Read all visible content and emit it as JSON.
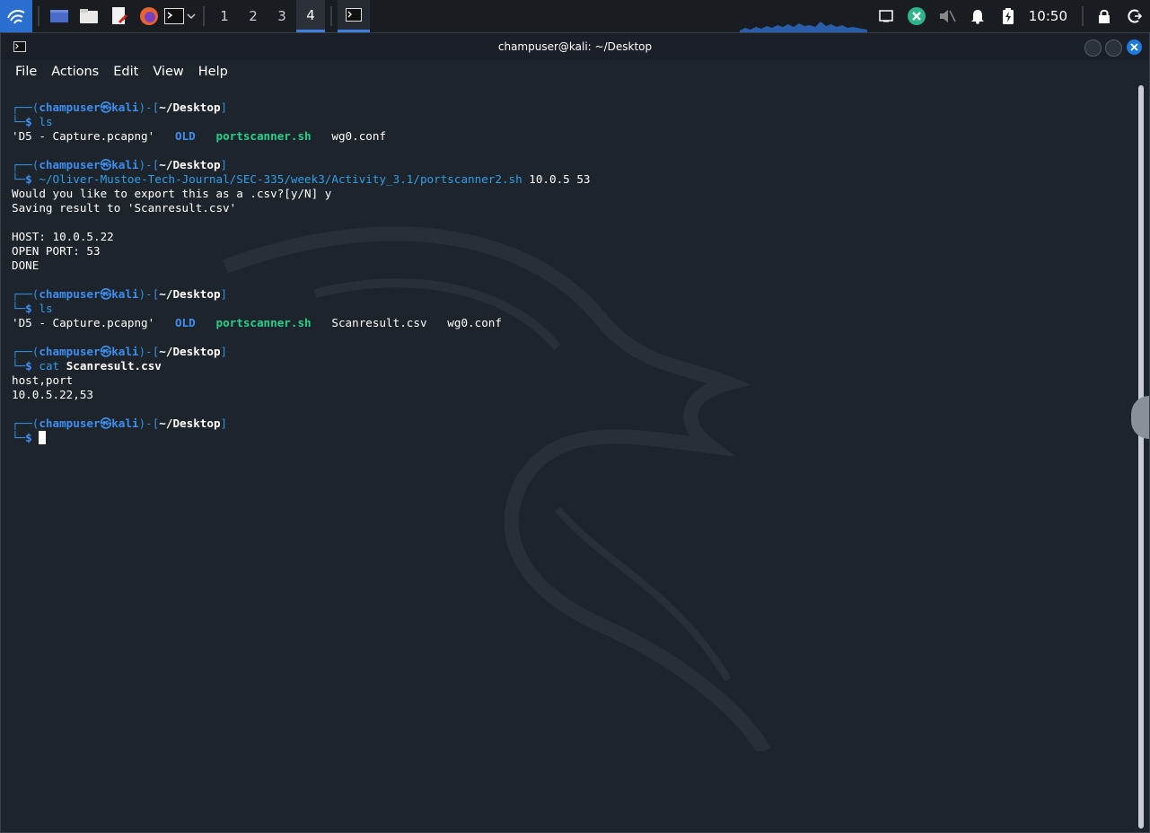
{
  "panel": {
    "workspaces": [
      "1",
      "2",
      "3",
      "4"
    ],
    "active_workspace": "4",
    "clock": "10:50"
  },
  "window": {
    "title": "champuser@kali: ~/Desktop",
    "menu": [
      "File",
      "Actions",
      "Edit",
      "View",
      "Help"
    ]
  },
  "terminal": {
    "user": "champuser",
    "host": "kali",
    "cwd": "~/Desktop",
    "blocks": [
      {
        "command": "ls",
        "output_files": [
          {
            "name": "'D5 - Capture.pcapng'",
            "kind": "plain"
          },
          {
            "name": "OLD",
            "kind": "dir"
          },
          {
            "name": "portscanner.sh",
            "kind": "exe"
          },
          {
            "name": "wg0.conf",
            "kind": "plain"
          }
        ]
      },
      {
        "command_path": "~/Oliver-Mustoe-Tech-Journal/SEC-335/week3/Activity_3.1/portscanner2.sh",
        "command_args": " 10.0.5 53",
        "output": [
          "Would you like to export this as a .csv?[y/N] y",
          "Saving result to 'Scanresult.csv'",
          "",
          "HOST: 10.0.5.22",
          "OPEN PORT: 53",
          "DONE"
        ]
      },
      {
        "command": "ls",
        "output_files": [
          {
            "name": "'D5 - Capture.pcapng'",
            "kind": "plain"
          },
          {
            "name": "OLD",
            "kind": "dir"
          },
          {
            "name": "portscanner.sh",
            "kind": "exe"
          },
          {
            "name": "Scanresult.csv",
            "kind": "plain"
          },
          {
            "name": "wg0.conf",
            "kind": "plain"
          }
        ]
      },
      {
        "command": "cat",
        "command_arg": "Scanresult.csv",
        "output": [
          "host,port",
          "10.0.5.22,53"
        ]
      }
    ],
    "final_prompt_symbol": "$"
  }
}
